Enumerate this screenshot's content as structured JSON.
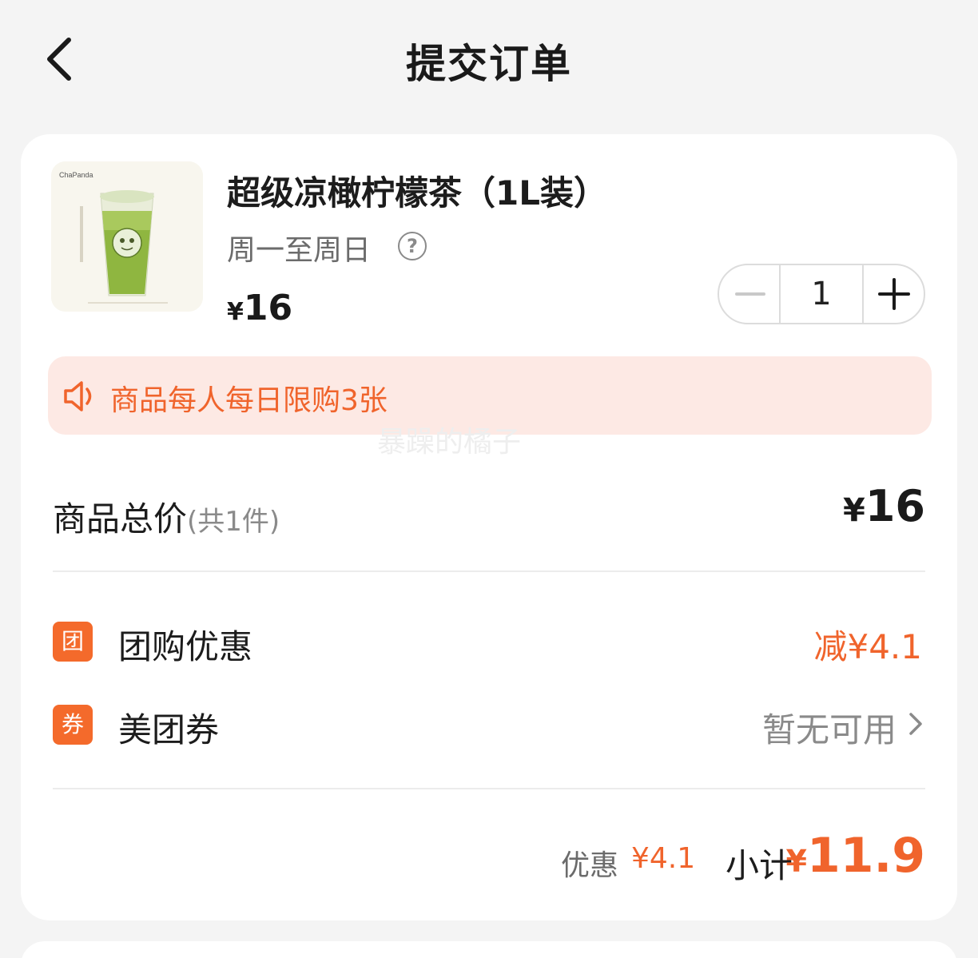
{
  "header": {
    "title": "提交订单"
  },
  "product": {
    "name": "超级凉橄柠檬茶（1L装）",
    "availability": "周一至周日",
    "help_icon_glyph": "?",
    "currency": "¥",
    "price": "16",
    "quantity": "1",
    "thumb_brand_text": "ChaPanda"
  },
  "notice": {
    "text": "商品每人每日限购3张"
  },
  "watermark": "暴躁的橘子",
  "summary": {
    "total_label": "商品总价",
    "total_count": "(共1件)",
    "total_currency": "¥",
    "total_price": "16"
  },
  "discounts": [
    {
      "badge": "团",
      "label": "团购优惠",
      "value": "减¥4.1"
    },
    {
      "badge": "券",
      "label": "美团券",
      "value": "暂无可用"
    }
  ],
  "subtotal": {
    "discount_label": "优惠",
    "discount_value": "¥4.1",
    "label": "小计",
    "currency": "¥",
    "value": "11.9"
  },
  "colors": {
    "accent": "#f0642c",
    "badge": "#f46a2b",
    "notice_bg": "#fde9e4",
    "page_bg": "#f4f4f4"
  },
  "icons": {
    "back": "chevron-left-icon",
    "notice": "speaker-icon",
    "help": "question-circle-icon",
    "more": "chevron-right-icon"
  }
}
